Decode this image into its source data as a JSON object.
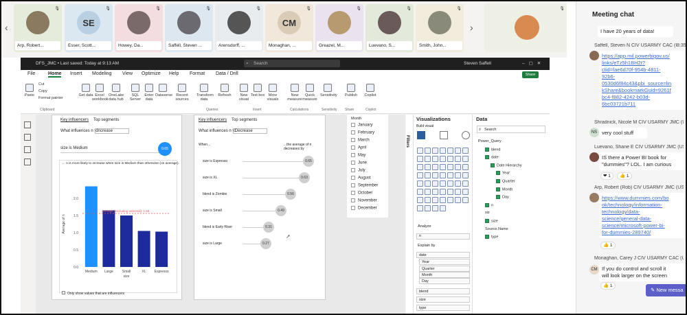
{
  "participants": [
    {
      "name": "Arp, Robert...",
      "initials": "",
      "bg": "#e6ecdb",
      "avbg": "#8a7a60"
    },
    {
      "name": "Esser, Scott...",
      "initials": "SE",
      "bg": "#dbe7f1",
      "avbg": "#b9cfe2"
    },
    {
      "name": "Howey, Da...",
      "initials": "",
      "bg": "#f3dde1",
      "avbg": "#7a6a6a"
    },
    {
      "name": "Saffell, Steven ...",
      "initials": "",
      "bg": "#dde7ef",
      "avbg": "#6a6a70"
    },
    {
      "name": "Arensdorff, ...",
      "initials": "",
      "bg": "#e9ecef",
      "avbg": "#555"
    },
    {
      "name": "Monaghan, ...",
      "initials": "CM",
      "bg": "#f1e7db",
      "avbg": "#d9cbb6"
    },
    {
      "name": "Greazel, M...",
      "initials": "",
      "bg": "#ebe2ef",
      "avbg": "#b89a70"
    },
    {
      "name": "Luevano, S...",
      "initials": "",
      "bg": "#e3eadb",
      "avbg": "#6a5a5a"
    },
    {
      "name": "Smith, John...",
      "initials": "",
      "bg": "#f1ecdb",
      "avbg": "#8a8a7a"
    },
    {
      "name": "",
      "initials": "",
      "bg": "#eef0e6",
      "avbg": "#d98a50"
    }
  ],
  "chat": {
    "title": "Meeting chat",
    "m0": "I have 20 years of data!",
    "m1_sender": "Saffell, Steven N CIV USARMY CAC (USA)",
    "m1_time": "8:35",
    "m1_lines": [
      "https://app.mil.powerbigov.us/",
      "links/eTz5h1BH2t?",
      "ctid=fae6d70f-954b-4811-",
      "92b6-",
      "0530d6f84c43&pbi_source=lin",
      "kShare&bookmarkGuid=9261f",
      "bc4-f882-4242-b03d-",
      "6bc03721b711"
    ],
    "m2_sender": "Shradnick, Nicole M CIV USARMY JMC (USA)",
    "m2_initials": "NS",
    "m2_text": "very cool stuff",
    "m3_sender": "Luevano, Shane E CIV USARMY JMC (USA)",
    "m3_lines": [
      "IS there a Power BI book for",
      "\"dummies\"? LOL. I am curious"
    ],
    "m3_react1": "❤ 1",
    "m3_react2": "👍 1",
    "m4_sender": "Arp, Robert (Rob) CIV USARMY JMC (USA)",
    "m4_lines": [
      "https://www.dummies.com/bo",
      "ok/technology/information-",
      "technology/data-",
      "science/general-data-",
      "science/microsoft-power-bi-",
      "for-dummies-289740/"
    ],
    "m4_react": "👍 1",
    "m5_sender": "Monaghan, Carey J CIV USARMY CAC (USA)",
    "m5_initials": "CM",
    "m5_lines": [
      "If you do control and scroll it",
      "will look larger on the screen"
    ],
    "m5_react": "👍 1",
    "new_message": "New messa"
  },
  "pbi": {
    "file": "DFS_JMC • Last saved: Today at 9:13 AM",
    "search": "Search",
    "user": "Steven Saffell",
    "share": "Share",
    "menu": [
      "File",
      "Home",
      "Insert",
      "Modeling",
      "View",
      "Optimize",
      "Help",
      "Format",
      "Data / Drill"
    ],
    "ribbon": {
      "clip": [
        "Cut",
        "Copy",
        "Format painter"
      ],
      "paste": "Paste",
      "clipboard": "Clipboard",
      "buttons": [
        "Get data",
        "Excel workbook",
        "OneLake data hub",
        "SQL Server",
        "Enter data",
        "Dataverse",
        "Recent sources",
        "Transform data",
        "Refresh",
        "New visual",
        "Text box",
        "More visuals",
        "New measure",
        "Quick measure",
        "Sensitivity",
        "Publish",
        "Copilot"
      ],
      "groups": [
        "Queries",
        "Insert",
        "Calculations",
        "Sensitivity",
        "Share",
        "Copilot"
      ]
    },
    "v1": {
      "tab1": "Key influencers",
      "tab2": "Top segments",
      "q": "What influences n to",
      "dd": "Increase",
      "header": "size is Medium",
      "bubble": "0.65",
      "note": "← n is more likely to increase when size is Medium than otherwise (on average).",
      "ylabel": "Average of n",
      "xlabel": "size",
      "avg": "Average (excluding selected): 1.56",
      "chk": "Only show values that are influencers"
    },
    "v2": {
      "tab1": "Key influencers",
      "tab2": "Top segments",
      "q": "What influences n to",
      "dd": "Decrease",
      "when": "When...",
      "avg": "...the average of n decreases by",
      "rows": [
        {
          "label": "size is Espresso",
          "value": "0.65"
        },
        {
          "label": "size is XL",
          "value": "0.63"
        },
        {
          "label": "blend is Zombie",
          "value": "0.56"
        },
        {
          "label": "size is Small",
          "value": "0.49"
        },
        {
          "label": "blend is Early Riser",
          "value": "0.31"
        },
        {
          "label": "size is Large",
          "value": "0.27"
        }
      ]
    },
    "slicer": {
      "title": "Month",
      "items": [
        "January",
        "February",
        "March",
        "April",
        "May",
        "June",
        "July",
        "August",
        "September",
        "October",
        "November",
        "December"
      ]
    },
    "filters": "Filters",
    "viz": {
      "title": "Visualizations",
      "build": "Build visual",
      "analyze": "Analyze",
      "n": "n",
      "explain": "Explain by",
      "fields": [
        "date",
        "Year",
        "Quarter",
        "Month",
        "Day",
        "blend",
        "size",
        "type"
      ]
    },
    "data": {
      "title": "Data",
      "search": "Search",
      "items": [
        "Power_Query",
        "blend",
        "date",
        "Date Hierarchy",
        "Year",
        "Quarter",
        "Month",
        "Day",
        "n",
        "siz",
        "size",
        "Source.Name",
        "type"
      ]
    }
  },
  "chart_data": {
    "type": "bar",
    "categories": [
      "Medium",
      "Large",
      "Small",
      "XL",
      "Espresso"
    ],
    "values": [
      2.35,
      1.65,
      1.5,
      1.05,
      1.03
    ],
    "xlabel": "size",
    "ylabel": "Average of n",
    "yticks": [
      "2.0",
      "1.5",
      "1.0",
      "0.5",
      "0.0"
    ],
    "ylim": [
      0,
      2.5
    ],
    "colors": [
      "#1e90ff",
      "#1c2a9c",
      "#1c2a9c",
      "#1c2a9c",
      "#1c2a9c"
    ]
  }
}
